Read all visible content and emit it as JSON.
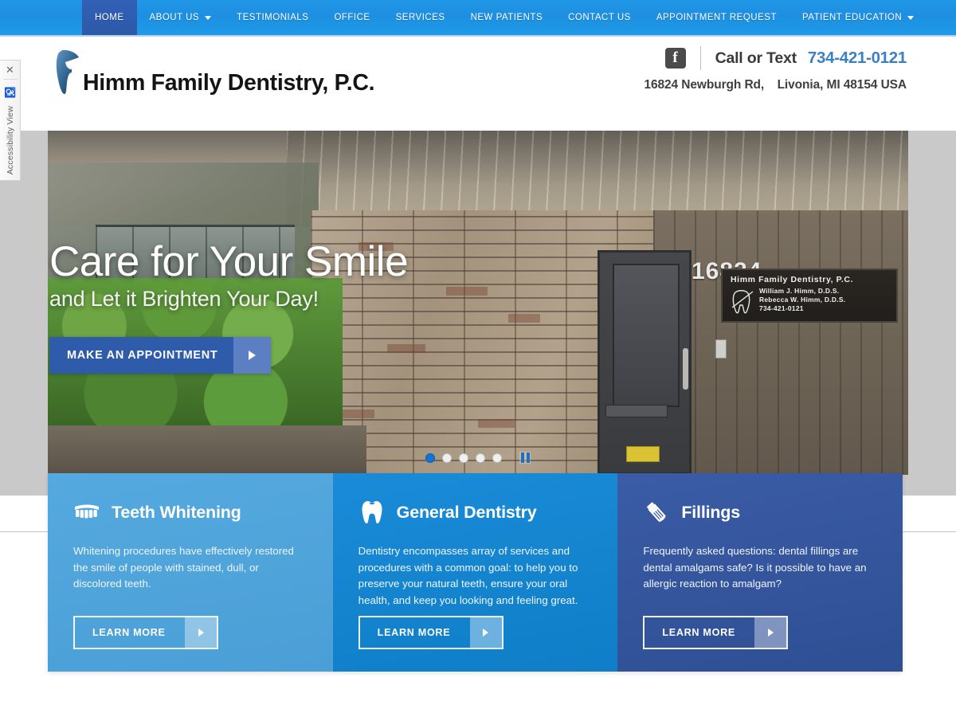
{
  "nav": {
    "items": [
      {
        "label": "HOME",
        "active": true,
        "caret": false
      },
      {
        "label": "ABOUT US",
        "active": false,
        "caret": true
      },
      {
        "label": "TESTIMONIALS",
        "active": false,
        "caret": false
      },
      {
        "label": "OFFICE",
        "active": false,
        "caret": false
      },
      {
        "label": "SERVICES",
        "active": false,
        "caret": false
      },
      {
        "label": "NEW PATIENTS",
        "active": false,
        "caret": false
      },
      {
        "label": "CONTACT US",
        "active": false,
        "caret": false
      },
      {
        "label": "APPOINTMENT REQUEST",
        "active": false,
        "caret": false
      },
      {
        "label": "PATIENT EDUCATION",
        "active": false,
        "caret": true
      }
    ]
  },
  "header": {
    "logo_text": "Himm Family Dentistry, P.C.",
    "facebook_glyph": "f",
    "call_label": "Call or Text",
    "phone": "734-421-0121",
    "address_street": "16824 Newburgh Rd,",
    "address_city": "Livonia, MI 48154 USA"
  },
  "hero": {
    "headline": "Care for Your Smile",
    "subhead": "and Let it Brighten Your Day!",
    "cta_label": "MAKE AN APPOINTMENT",
    "door_number": "16824",
    "sign_title": "Himm Family Dentistry, P.C.",
    "sign_line1": "William J. Himm, D.D.S.",
    "sign_line2": "Rebecca W. Himm, D.D.S.",
    "sign_line3": "734-421-0121",
    "slides": [
      {
        "index": 1,
        "active": true
      },
      {
        "index": 2,
        "active": false
      },
      {
        "index": 3,
        "active": false
      },
      {
        "index": 4,
        "active": false
      },
      {
        "index": 5,
        "active": false
      }
    ],
    "pause_label": "Pause slideshow"
  },
  "cards": [
    {
      "icon": "denture-teeth-icon",
      "title": "Teeth Whitening",
      "text": "Whitening procedures have effectively restored the smile of people with stained, dull, or discolored teeth.",
      "button": "LEARN MORE",
      "color": "#4ea3da"
    },
    {
      "icon": "molar-tooth-icon",
      "title": "General Dentistry",
      "text": "Dentistry encompasses array of services and procedures with a common goal: to help you to preserve your natural teeth, ensure your oral health, and keep you looking and feeling great.",
      "button": "LEARN MORE",
      "color": "#1383ce"
    },
    {
      "icon": "toothpaste-tube-icon",
      "title": "Fillings",
      "text": "Frequently asked questions: dental fillings are dental amalgams safe? Is it possible to have an allergic reaction to amalgam?",
      "button": "LEARN MORE",
      "color": "#33539b"
    }
  ],
  "accessibility": {
    "close_glyph": "✕",
    "wheelchair_glyph": "♿",
    "label": "Accessibility View"
  }
}
